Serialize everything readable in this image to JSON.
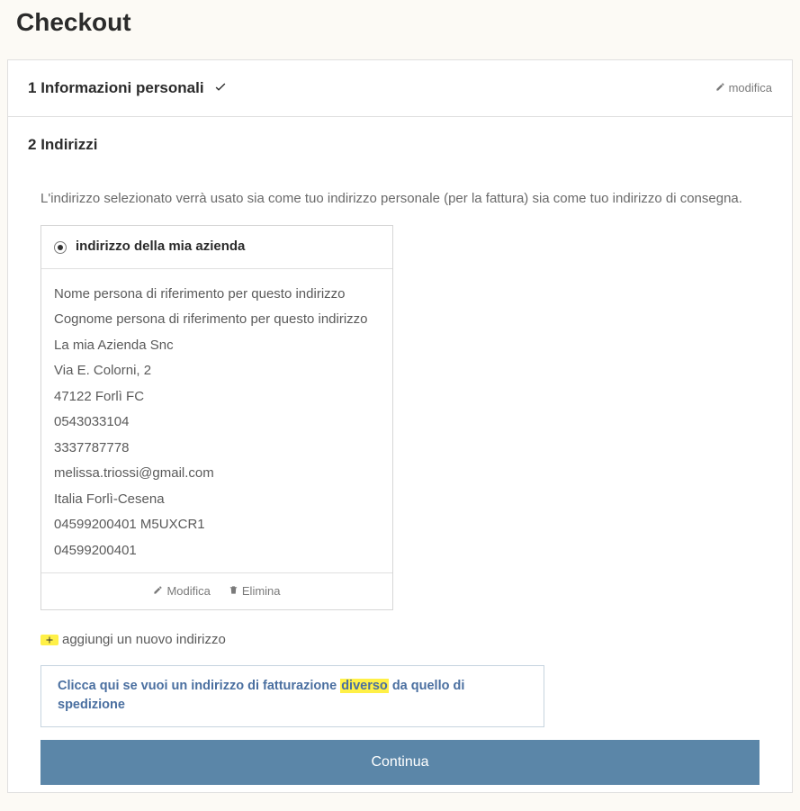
{
  "page": {
    "title": "Checkout"
  },
  "steps": {
    "s1": {
      "num": "1",
      "title": "Informazioni personali",
      "edit": "modifica"
    },
    "s2": {
      "num": "2",
      "title": "Indirizzi"
    }
  },
  "addresses": {
    "helper": "L'indirizzo selezionato verrà usato sia come tuo indirizzo personale (per la fattura) sia come tuo indirizzo di consegna.",
    "card": {
      "alias": "indirizzo della mia azienda",
      "lines": {
        "l0": "Nome persona di riferimento per questo indirizzo",
        "l1": "Cognome persona di riferimento per questo indirizzo",
        "l2": "La mia Azienda Snc",
        "l3": "Via E. Colorni, 2",
        "l4": "47122 Forlì FC",
        "l5": "0543033104",
        "l6": "3337787778",
        "l7": "melissa.triossi@gmail.com",
        "l8": "Italia Forlì-Cesena",
        "l9": "04599200401 M5UXCR1",
        "l10": "04599200401"
      },
      "actions": {
        "edit": "Modifica",
        "delete": "Elimina"
      }
    },
    "add_new": "aggiungi un nuovo indirizzo",
    "different_invoice": {
      "pre": "Clicca qui se vuoi un indirizzo di fatturazione ",
      "hl": "diverso",
      "post": " da quello di spedizione"
    },
    "continue": "Continua"
  }
}
